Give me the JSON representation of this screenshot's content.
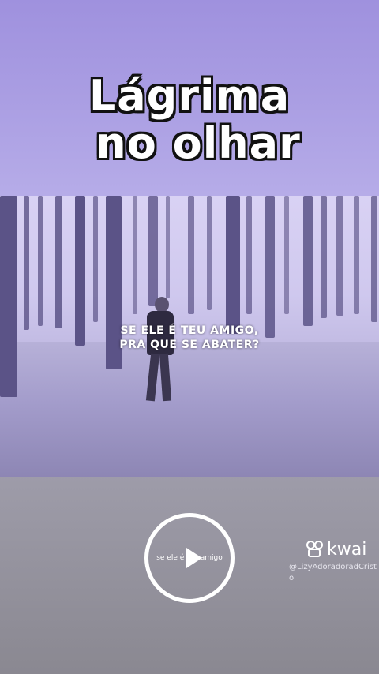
{
  "title": {
    "line1": "Lágrima",
    "line2": "no olhar"
  },
  "video": {
    "caption_line1": "SE ELE É TEU AMIGO,",
    "caption_line2": "PRA QUE SE ABATER?"
  },
  "player": {
    "play_label": "se ele é teu amigo",
    "icon": "play-icon"
  },
  "watermark": {
    "brand": "kwai",
    "handle": "@LizyAdoradoradCristo",
    "icon": "kwai-logo-icon"
  }
}
